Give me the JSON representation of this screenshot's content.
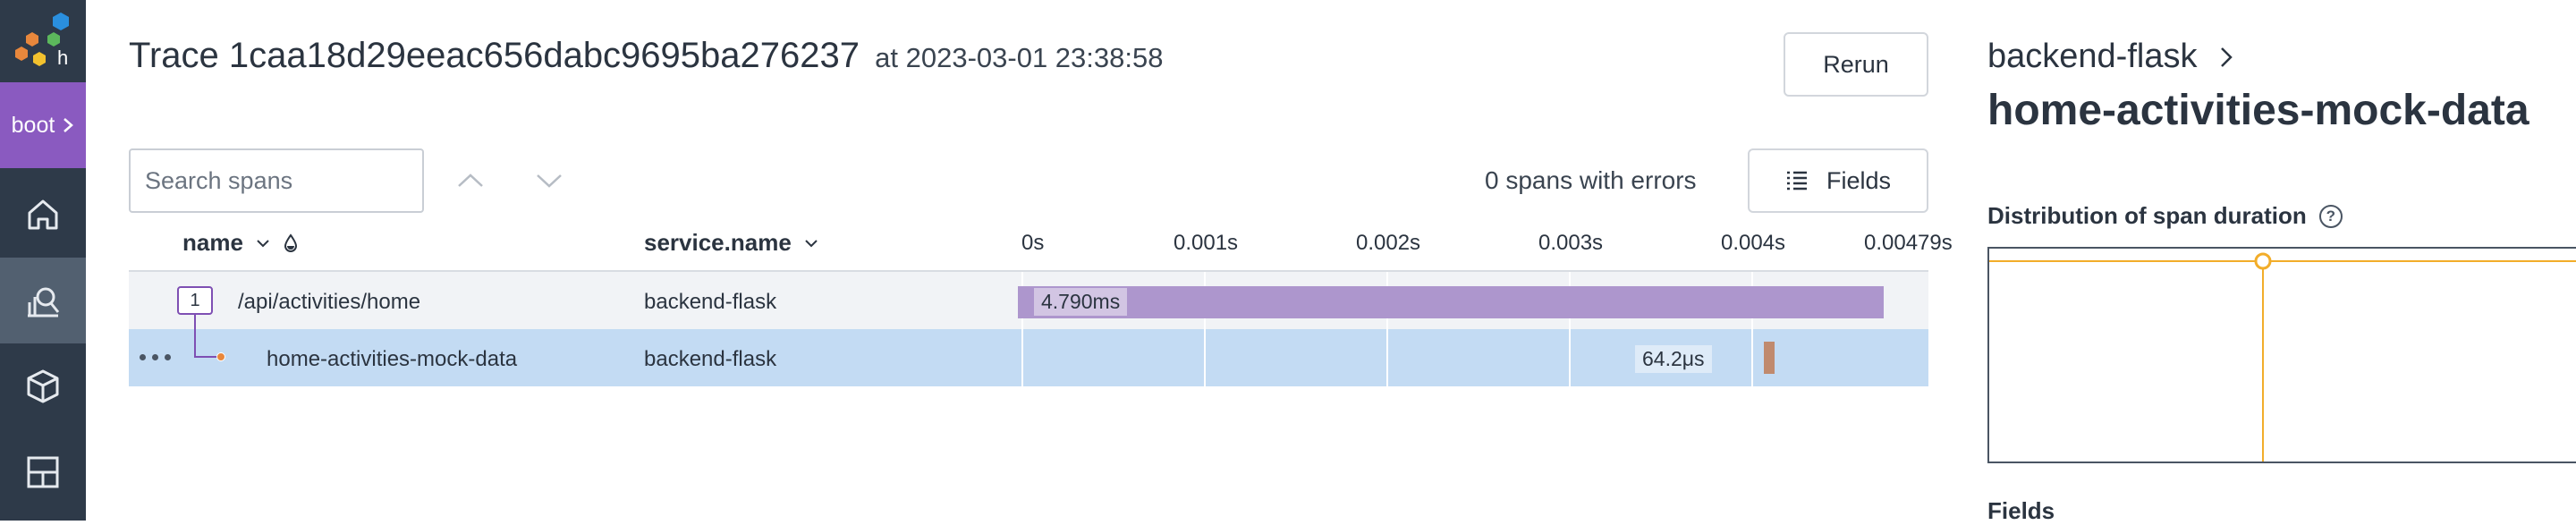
{
  "env": {
    "label": "boot"
  },
  "nav": [
    "home-icon",
    "query-icon",
    "datasets-icon",
    "boards-icon"
  ],
  "trace": {
    "title": "Trace 1caa18d29eeac656dabc9695ba276237",
    "at": "at 2023-03-01 23:38:58"
  },
  "toolbar": {
    "rerun_label": "Rerun",
    "search_placeholder": "Search spans",
    "errors": "0 spans with errors",
    "fields_label": "Fields"
  },
  "table": {
    "headers": {
      "name": "name",
      "service": "service.name"
    },
    "ticks": [
      "0s",
      "0.001s",
      "0.002s",
      "0.003s",
      "0.004s",
      "0.00479s"
    ],
    "rows": [
      {
        "count": "1",
        "name": "/api/activities/home",
        "service": "backend-flask",
        "duration": "4.790ms"
      },
      {
        "name": "home-activities-mock-data",
        "service": "backend-flask",
        "duration": "64.2μs"
      }
    ]
  },
  "panel": {
    "service": "backend-flask",
    "span_name": "home-activities-mock-data",
    "distribution_title": "Distribution of span duration",
    "help": "?",
    "fields_title": "Fields"
  },
  "colors": {
    "rail": "#2e3a49",
    "env": "#8a5ac0",
    "bar_parent": "#ad96cd",
    "bar_child": "#c08a6e",
    "selected_row": "#c3dbf3",
    "chart_line": "#f2ad2a"
  }
}
